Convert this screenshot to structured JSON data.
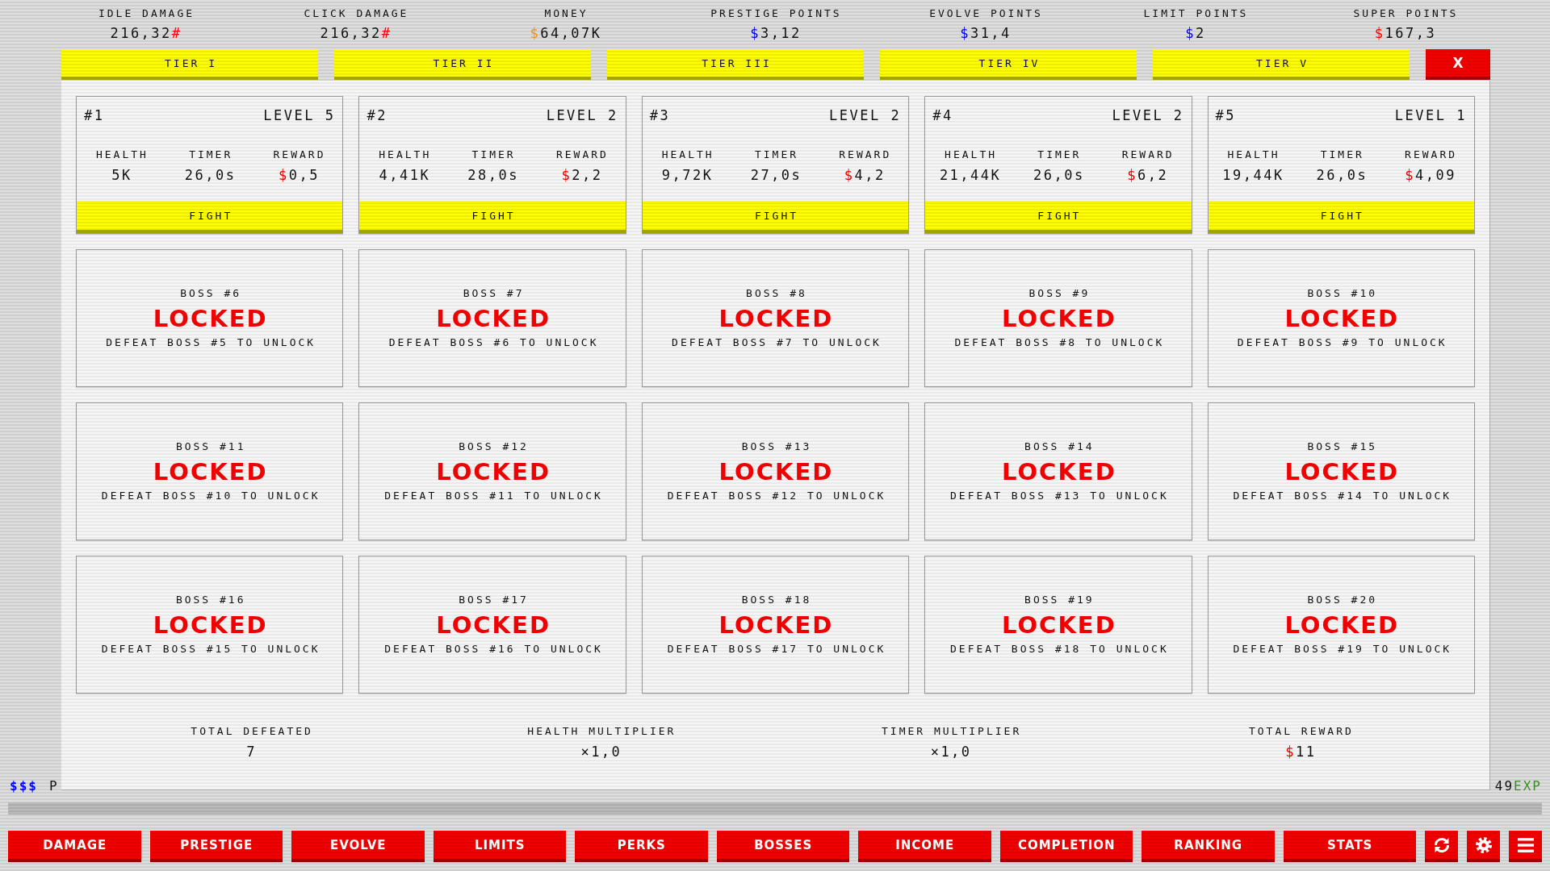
{
  "stats": [
    {
      "label": "IDLE DAMAGE",
      "value": "216,32",
      "suffix": {
        "text": "#",
        "color": "#ff0000"
      }
    },
    {
      "label": "CLICK DAMAGE",
      "value": "216,32",
      "suffix": {
        "text": "#",
        "color": "#ff0000"
      }
    },
    {
      "label": "MONEY",
      "prefix": {
        "text": "$",
        "color": "#e8962a"
      },
      "value": "64,07K"
    },
    {
      "label": "PRESTIGE POINTS",
      "prefix": {
        "text": "$",
        "color": "#0000ff"
      },
      "value": "3,12"
    },
    {
      "label": "EVOLVE POINTS",
      "prefix": {
        "text": "$",
        "color": "#0000ff"
      },
      "value": "31,4"
    },
    {
      "label": "LIMIT POINTS",
      "prefix": {
        "text": "$",
        "color": "#0000ff"
      },
      "value": "2"
    },
    {
      "label": "SUPER POINTS",
      "prefix": {
        "text": "$",
        "color": "#ff0000"
      },
      "value": "167,3"
    }
  ],
  "tiers": [
    "TIER I",
    "TIER II",
    "TIER III",
    "TIER IV",
    "TIER V"
  ],
  "close_button": "X",
  "bosses": [
    {
      "kind": "active",
      "number": "#1",
      "level_text": "LEVEL 5",
      "stats": [
        {
          "label": "HEALTH",
          "value": "5K"
        },
        {
          "label": "TIMER",
          "value": "26,0s"
        },
        {
          "label": "REWARD",
          "prefix": "$",
          "value": "0,5"
        }
      ],
      "button": "FIGHT"
    },
    {
      "kind": "active",
      "number": "#2",
      "level_text": "LEVEL 2",
      "stats": [
        {
          "label": "HEALTH",
          "value": "4,41K"
        },
        {
          "label": "TIMER",
          "value": "28,0s"
        },
        {
          "label": "REWARD",
          "prefix": "$",
          "value": "2,2"
        }
      ],
      "button": "FIGHT"
    },
    {
      "kind": "active",
      "number": "#3",
      "level_text": "LEVEL 2",
      "stats": [
        {
          "label": "HEALTH",
          "value": "9,72K"
        },
        {
          "label": "TIMER",
          "value": "27,0s"
        },
        {
          "label": "REWARD",
          "prefix": "$",
          "value": "4,2"
        }
      ],
      "button": "FIGHT"
    },
    {
      "kind": "active",
      "number": "#4",
      "level_text": "LEVEL 2",
      "stats": [
        {
          "label": "HEALTH",
          "value": "21,44K"
        },
        {
          "label": "TIMER",
          "value": "26,0s"
        },
        {
          "label": "REWARD",
          "prefix": "$",
          "value": "6,2"
        }
      ],
      "button": "FIGHT"
    },
    {
      "kind": "active",
      "number": "#5",
      "level_text": "LEVEL 1",
      "stats": [
        {
          "label": "HEALTH",
          "value": "19,44K"
        },
        {
          "label": "TIMER",
          "value": "26,0s"
        },
        {
          "label": "REWARD",
          "prefix": "$",
          "value": "4,09"
        }
      ],
      "button": "FIGHT"
    },
    {
      "kind": "locked",
      "title": "BOSS #6",
      "status": "LOCKED",
      "hint": "DEFEAT BOSS #5 TO UNLOCK"
    },
    {
      "kind": "locked",
      "title": "BOSS #7",
      "status": "LOCKED",
      "hint": "DEFEAT BOSS #6 TO UNLOCK"
    },
    {
      "kind": "locked",
      "title": "BOSS #8",
      "status": "LOCKED",
      "hint": "DEFEAT BOSS #7 TO UNLOCK"
    },
    {
      "kind": "locked",
      "title": "BOSS #9",
      "status": "LOCKED",
      "hint": "DEFEAT BOSS #8 TO UNLOCK"
    },
    {
      "kind": "locked",
      "title": "BOSS #10",
      "status": "LOCKED",
      "hint": "DEFEAT BOSS #9 TO UNLOCK"
    },
    {
      "kind": "locked",
      "title": "BOSS #11",
      "status": "LOCKED",
      "hint": "DEFEAT BOSS #10 TO UNLOCK"
    },
    {
      "kind": "locked",
      "title": "BOSS #12",
      "status": "LOCKED",
      "hint": "DEFEAT BOSS #11 TO UNLOCK"
    },
    {
      "kind": "locked",
      "title": "BOSS #13",
      "status": "LOCKED",
      "hint": "DEFEAT BOSS #12 TO UNLOCK"
    },
    {
      "kind": "locked",
      "title": "BOSS #14",
      "status": "LOCKED",
      "hint": "DEFEAT BOSS #13 TO UNLOCK"
    },
    {
      "kind": "locked",
      "title": "BOSS #15",
      "status": "LOCKED",
      "hint": "DEFEAT BOSS #14 TO UNLOCK"
    },
    {
      "kind": "locked",
      "title": "BOSS #16",
      "status": "LOCKED",
      "hint": "DEFEAT BOSS #15 TO UNLOCK"
    },
    {
      "kind": "locked",
      "title": "BOSS #17",
      "status": "LOCKED",
      "hint": "DEFEAT BOSS #16 TO UNLOCK"
    },
    {
      "kind": "locked",
      "title": "BOSS #18",
      "status": "LOCKED",
      "hint": "DEFEAT BOSS #17 TO UNLOCK"
    },
    {
      "kind": "locked",
      "title": "BOSS #19",
      "status": "LOCKED",
      "hint": "DEFEAT BOSS #18 TO UNLOCK"
    },
    {
      "kind": "locked",
      "title": "BOSS #20",
      "status": "LOCKED",
      "hint": "DEFEAT BOSS #19 TO UNLOCK"
    }
  ],
  "summary": [
    {
      "label": "TOTAL DEFEATED",
      "value": "7"
    },
    {
      "label": "HEALTH MULTIPLIER",
      "value": "×1,0"
    },
    {
      "label": "TIMER MULTIPLIER",
      "value": "×1,0"
    },
    {
      "label": "TOTAL REWARD",
      "prefix": "$",
      "value": "11"
    }
  ],
  "progress": {
    "symbols": "$$$",
    "label": "P",
    "value": "49",
    "unit": "EXP"
  },
  "nav": [
    "DAMAGE",
    "PRESTIGE",
    "EVOLVE",
    "LIMITS",
    "PERKS",
    "BOSSES",
    "INCOME",
    "COMPLETION",
    "RANKING",
    "STATS"
  ]
}
